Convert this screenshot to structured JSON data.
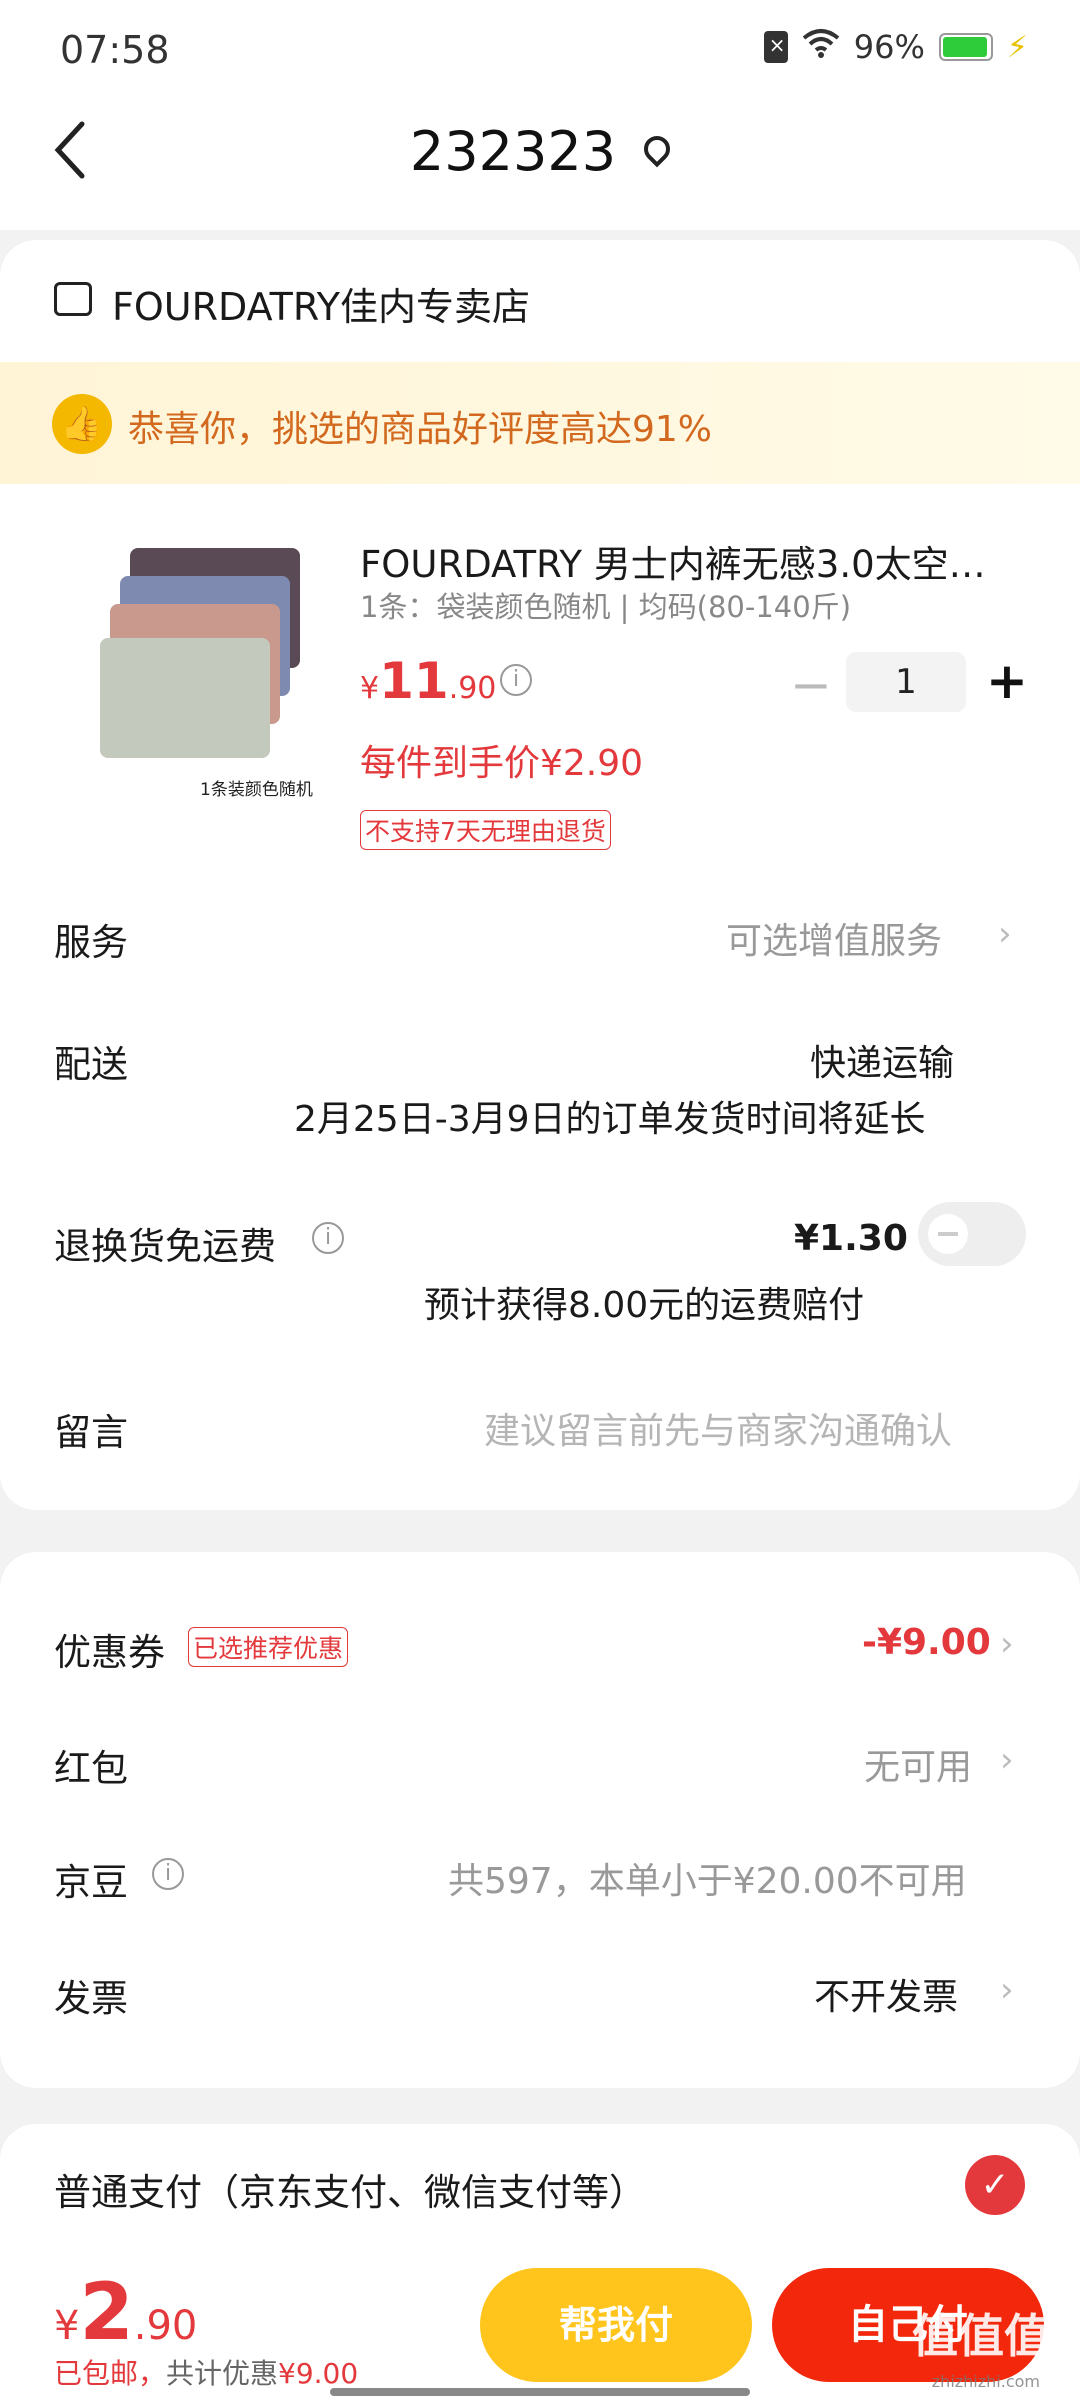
{
  "status_bar": {
    "time": "07:58",
    "battery_pct": "96%",
    "battery_level": 0.96
  },
  "header": {
    "title": "232323"
  },
  "store": {
    "name": "FOURDATRY佳内专卖店"
  },
  "praise": {
    "text": "恭喜你，挑选的商品好评度高达91%"
  },
  "product": {
    "image_caption": "1条装颜色随机",
    "title": "FOURDATRY 男士内裤无感3.0太空…",
    "spec": "1条：袋装颜色随机 | 均码(80-140斤)",
    "price_currency": "¥",
    "price_int": "11",
    "price_dec": ".90",
    "quantity": "1",
    "unit_price_label": "每件到手价¥2.90",
    "no_return_tag": "不支持7天无理由退货"
  },
  "rows": {
    "service": {
      "label": "服务",
      "value": "可选增值服务"
    },
    "delivery": {
      "label": "配送",
      "value": "快递运输",
      "note": "2月25日-3月9日的订单发货时间将延长"
    },
    "return_shipping": {
      "label": "退换货免运费",
      "value": "¥1.30",
      "note": "预计获得8.00元的运费赔付",
      "enabled": false
    },
    "message": {
      "label": "留言",
      "placeholder": "建议留言前先与商家沟通确认"
    }
  },
  "discounts": {
    "coupon": {
      "label": "优惠券",
      "tag": "已选推荐优惠",
      "value": "-¥9.00"
    },
    "red_packet": {
      "label": "红包",
      "value": "无可用"
    },
    "jd_beans": {
      "label": "京豆",
      "value": "共597，本单小于¥20.00不可用"
    },
    "invoice": {
      "label": "发票",
      "value": "不开发票"
    }
  },
  "payment": {
    "label": "普通支付（京东支付、微信支付等）",
    "selected": true
  },
  "footer": {
    "currency": "¥",
    "total_int": "2",
    "total_dec": ".90",
    "shipping_note": "已包邮，",
    "discount_prefix": "共计优惠",
    "discount_value": "¥9.00",
    "help_pay": "帮我付",
    "self_pay": "自己付"
  },
  "watermark": {
    "text": "值值值",
    "sub": "zhizhizhi.com"
  },
  "colors": {
    "accent_red": "#e4393c",
    "pay_red": "#f2270c",
    "help_yellow": "#ffc51c",
    "praise_orange": "#d2691e"
  }
}
